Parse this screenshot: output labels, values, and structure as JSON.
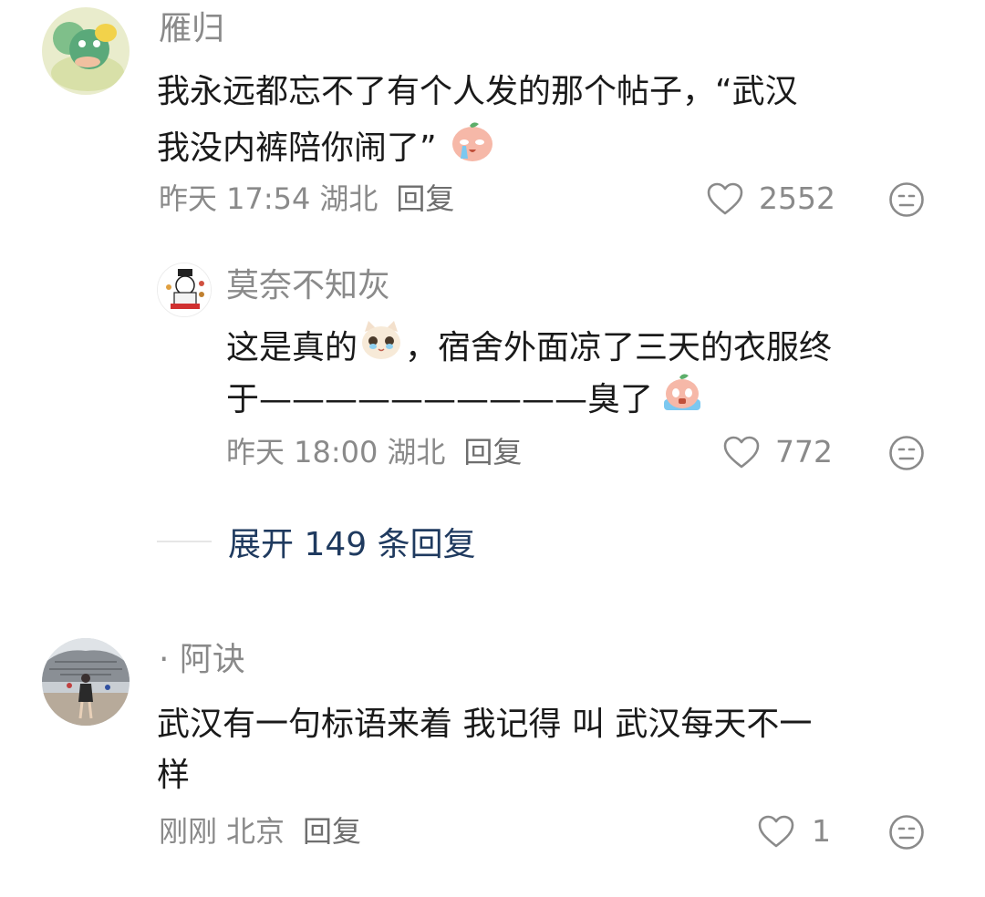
{
  "comments": [
    {
      "username": "雁归",
      "text_line1": "我永远都忘不了有个人发的那个帖子，“武汉",
      "text_line2": "我没内裤陪你闹了”",
      "time": "昨天 17:54",
      "location": "湖北",
      "reply_label": "回复",
      "likes": "2552"
    },
    {
      "username": "莫奈不知灰",
      "text_line1_a": "这是真的",
      "text_line1_b": "，宿舍外面凉了三天的衣服终",
      "text_line2": "于——————————臭了",
      "time": "昨天 18:00",
      "location": "湖北",
      "reply_label": "回复",
      "likes": "772"
    },
    {
      "username": "· 阿诀",
      "text_line1": "武汉有一句标语来着 我记得 叫 武汉每天不一",
      "text_line2": "样",
      "time": "刚刚",
      "location": "北京",
      "reply_label": "回复",
      "likes": "1"
    }
  ],
  "expand_replies": "展开 149 条回复",
  "colors": {
    "text": "#1a1a1a",
    "meta": "#8a8a8a",
    "link": "#1f3a5f"
  }
}
